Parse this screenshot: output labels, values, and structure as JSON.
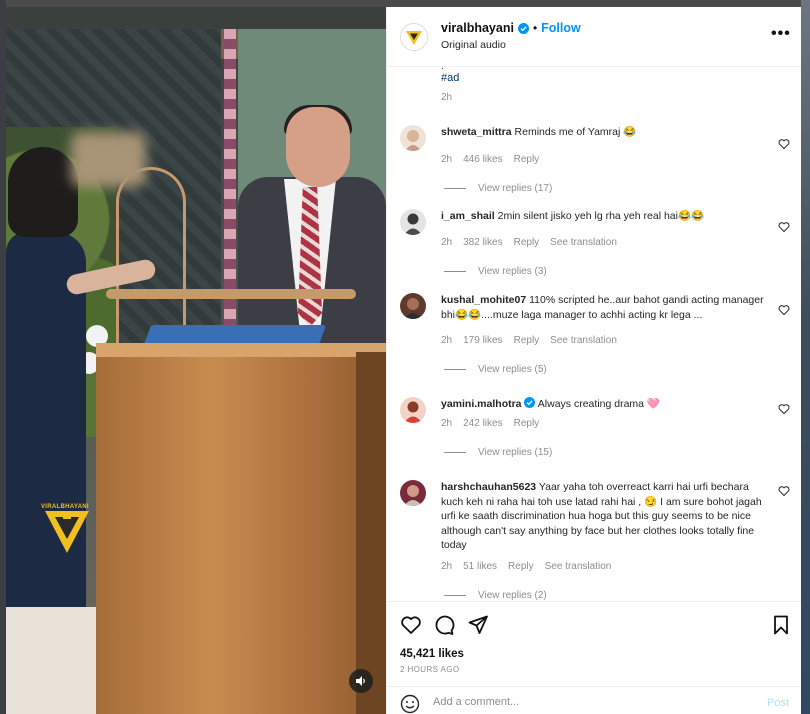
{
  "header": {
    "username": "viralbhayani",
    "separator": "•",
    "follow_label": "Follow",
    "subtitle": "Original audio",
    "more_label": "•••"
  },
  "caption": {
    "fragment": ".",
    "tag": "#ad",
    "time": "2h"
  },
  "media": {
    "watermark": "VIRALBHAYANI"
  },
  "comments": [
    {
      "username": "shweta_mittra",
      "verified": false,
      "text": "Reminds me of Yamraj 😂",
      "time": "2h",
      "likes": "446 likes",
      "reply": "Reply",
      "translation": "",
      "replies": "View replies (17)",
      "avatar_color": "#e8d6c6"
    },
    {
      "username": "i_am_shail",
      "verified": false,
      "text": "2min silent jisko yeh lg rha yeh real hai😂😂",
      "time": "2h",
      "likes": "382 likes",
      "reply": "Reply",
      "translation": "See translation",
      "replies": "View replies (3)",
      "avatar_color": "#6d6d6d"
    },
    {
      "username": "kushal_mohite07",
      "verified": false,
      "text": "110% scripted he..aur bahot gandi acting manager bhi😂😂....muze laga manager to achhi acting kr lega ...",
      "time": "2h",
      "likes": "179 likes",
      "reply": "Reply",
      "translation": "See translation",
      "replies": "View replies (5)",
      "avatar_color": "#7a4b3a"
    },
    {
      "username": "yamini.malhotra",
      "verified": true,
      "text": "Always creating drama 🩷",
      "time": "2h",
      "likes": "242 likes",
      "reply": "Reply",
      "translation": "",
      "replies": "View replies (15)",
      "avatar_color": "#d9402f"
    },
    {
      "username": "harshchauhan5623",
      "verified": false,
      "text": "Yaar yaha toh overreact karri hai urfi bechara kuch keh ni raha hai toh use latad rahi hai , 😏 I am sure bohot jagah urfi ke saath discrimination hua hoga but this guy seems to be nice although can't say anything by face but her clothes looks totally fine today",
      "time": "2h",
      "likes": "51 likes",
      "reply": "Reply",
      "translation": "See translation",
      "replies": "View replies (2)",
      "avatar_color": "#9a3a4a"
    }
  ],
  "footer": {
    "likes": "45,421 likes",
    "ago": "2 HOURS AGO",
    "comment_placeholder": "Add a comment...",
    "post_label": "Post"
  },
  "colors": {
    "link_blue": "#0095f6",
    "hashtag": "#00376b",
    "muted": "#8e8e8e",
    "verified_blue": "#0095f6",
    "brand_yellow": "#f0c020"
  }
}
